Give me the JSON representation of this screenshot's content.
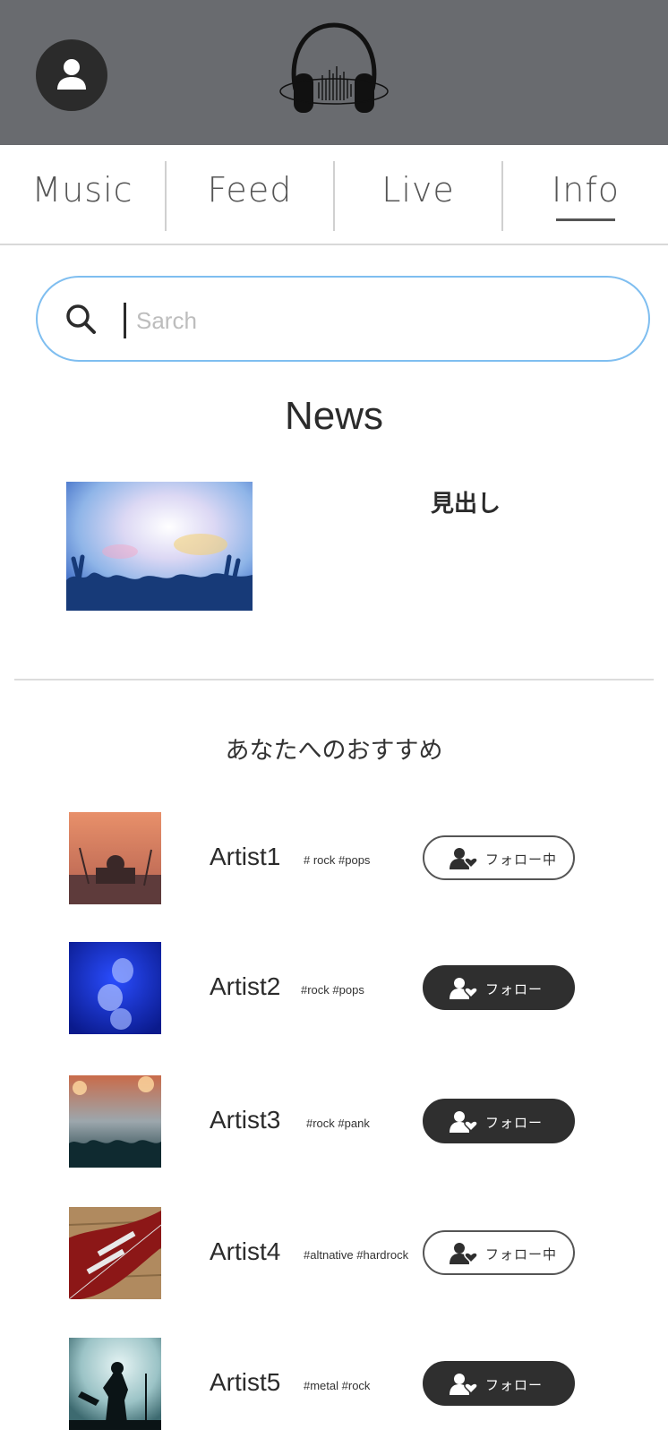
{
  "header": {
    "profile_icon": "person-icon",
    "logo_icon": "headphones-logo"
  },
  "nav": {
    "tabs": [
      "Music",
      "Feed",
      "Live",
      "Info"
    ],
    "active": "Info"
  },
  "search": {
    "placeholder": "Sarch",
    "icon": "search-icon"
  },
  "news": {
    "title": "News",
    "headline": "見出し"
  },
  "recommend": {
    "title": "あなたへのおすすめ",
    "artists": [
      {
        "name": "Artist1",
        "tags": "# rock #pops",
        "follow_label": "フォロー中",
        "following": true
      },
      {
        "name": "Artist2",
        "tags": "#rock #pops",
        "follow_label": "フォロー",
        "following": false
      },
      {
        "name": "Artist3",
        "tags": "#rock #pank",
        "follow_label": "フォロー",
        "following": false
      },
      {
        "name": "Artist4",
        "tags": "#altnative #hardrock",
        "follow_label": "フォロー中",
        "following": true
      },
      {
        "name": "Artist5",
        "tags": "#metal #rock",
        "follow_label": "フォロー",
        "following": false
      }
    ]
  },
  "colors": {
    "header_bg": "#696b6f",
    "search_border": "#7fbef0",
    "follow_dark": "#2f2f2f"
  }
}
